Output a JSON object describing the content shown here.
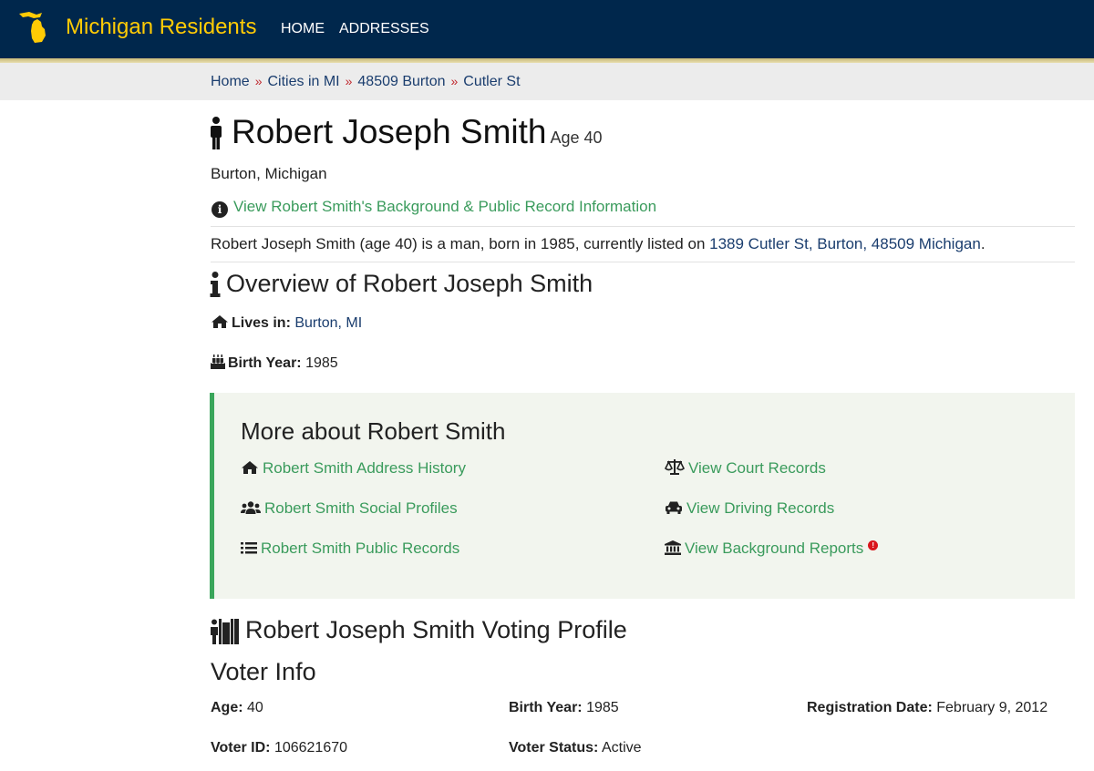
{
  "nav": {
    "brand": "Michigan Residents",
    "links": [
      "HOME",
      "ADDRESSES"
    ]
  },
  "breadcrumb": [
    "Home",
    "Cities in MI",
    "48509 Burton",
    "Cutler St"
  ],
  "breadcrumb_separator": "»",
  "person": {
    "name": "Robert Joseph Smith",
    "age_label": "Age 40",
    "location": "Burton, Michigan",
    "background_link": "View Robert Smith's Background & Public Record Information",
    "summary_text": "Robert Joseph Smith (age 40) is a man, born in 1985, currently listed on",
    "summary_address": "1389 Cutler St, Burton, 48509 Michigan",
    "summary_end": "."
  },
  "overview": {
    "title": "Overview of Robert Joseph Smith",
    "lives_in_label": "Lives in:",
    "lives_in_value": "Burton, MI",
    "birth_year_label": "Birth Year:",
    "birth_year_value": "1985"
  },
  "more_about": {
    "title": "More about Robert Smith",
    "left_links": [
      {
        "label": "Robert Smith Address History",
        "icon": "home-icon"
      },
      {
        "label": "Robert Smith Social Profiles",
        "icon": "users-icon"
      },
      {
        "label": "Robert Smith Public Records",
        "icon": "list-icon"
      }
    ],
    "right_links": [
      {
        "label": "View Court Records",
        "icon": "balance-scale-icon"
      },
      {
        "label": "View Driving Records",
        "icon": "car-icon"
      },
      {
        "label": "View Background Reports",
        "icon": "bank-icon"
      }
    ],
    "alert_badge": "!"
  },
  "voting": {
    "title": "Robert Joseph Smith Voting Profile",
    "voter_info_title": "Voter Info",
    "fields": {
      "age_label": "Age:",
      "age_value": "40",
      "birth_year_label": "Birth Year:",
      "birth_year_value": "1985",
      "registration_label": "Registration Date:",
      "registration_value": "February 9, 2012",
      "voter_id_label": "Voter ID:",
      "voter_id_value": "106621670",
      "status_label": "Voter Status:",
      "status_value": "Active"
    }
  },
  "colors": {
    "navbar": "#00274c",
    "brand": "#ffcb05",
    "link_green": "#3a9b5c",
    "link_blue": "#1a3d6e",
    "breadcrumb_separator": "#c0272d",
    "more_box_bg": "#f2f5ee",
    "more_box_border": "#3aa65b"
  }
}
